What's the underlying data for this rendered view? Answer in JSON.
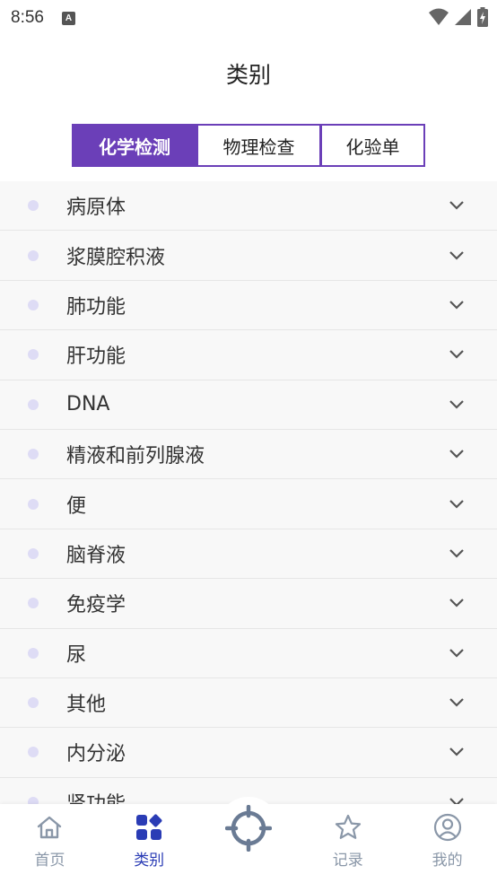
{
  "status": {
    "time": "8:56",
    "notif_icon": "A"
  },
  "header": {
    "title": "类别"
  },
  "tabs": [
    {
      "label": "化学检测",
      "active": true
    },
    {
      "label": "物理检查",
      "active": false
    },
    {
      "label": "化验单",
      "active": false
    }
  ],
  "list": {
    "items": [
      {
        "label": "病原体"
      },
      {
        "label": "浆膜腔积液"
      },
      {
        "label": "肺功能"
      },
      {
        "label": "肝功能"
      },
      {
        "label": "DNA"
      },
      {
        "label": "精液和前列腺液"
      },
      {
        "label": "便"
      },
      {
        "label": "脑脊液"
      },
      {
        "label": "免疫学"
      },
      {
        "label": "尿"
      },
      {
        "label": "其他"
      },
      {
        "label": "内分泌"
      },
      {
        "label": "肾功能"
      }
    ]
  },
  "nav": {
    "home": "首页",
    "category": "类别",
    "record": "记录",
    "mine": "我的"
  },
  "colors": {
    "accent": "#6b3fb8",
    "nav_active": "#2a3cb5",
    "nav_inactive": "#8a97a8"
  }
}
